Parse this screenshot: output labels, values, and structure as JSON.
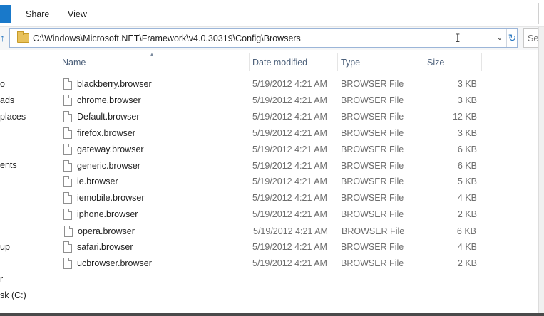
{
  "ribbon": {
    "tabs": [
      "Share",
      "View"
    ]
  },
  "address": {
    "path": "C:\\Windows\\Microsoft.NET\\Framework\\v4.0.30319\\Config\\Browsers",
    "cursor_glyph": "I",
    "dropdown_glyph": "⌄",
    "refresh_glyph": "↻",
    "search_partial": "Se"
  },
  "nav": {
    "items": [
      "o",
      "ads",
      "places",
      "",
      "ents",
      "",
      "up",
      "r",
      "sk (C:)"
    ]
  },
  "columns": {
    "name": "Name",
    "date": "Date modified",
    "type": "Type",
    "size": "Size"
  },
  "files": [
    {
      "name": "blackberry.browser",
      "date": "5/19/2012 4:21 AM",
      "type": "BROWSER File",
      "size": "3 KB"
    },
    {
      "name": "chrome.browser",
      "date": "5/19/2012 4:21 AM",
      "type": "BROWSER File",
      "size": "3 KB"
    },
    {
      "name": "Default.browser",
      "date": "5/19/2012 4:21 AM",
      "type": "BROWSER File",
      "size": "12 KB"
    },
    {
      "name": "firefox.browser",
      "date": "5/19/2012 4:21 AM",
      "type": "BROWSER File",
      "size": "3 KB"
    },
    {
      "name": "gateway.browser",
      "date": "5/19/2012 4:21 AM",
      "type": "BROWSER File",
      "size": "6 KB"
    },
    {
      "name": "generic.browser",
      "date": "5/19/2012 4:21 AM",
      "type": "BROWSER File",
      "size": "6 KB"
    },
    {
      "name": "ie.browser",
      "date": "5/19/2012 4:21 AM",
      "type": "BROWSER File",
      "size": "5 KB"
    },
    {
      "name": "iemobile.browser",
      "date": "5/19/2012 4:21 AM",
      "type": "BROWSER File",
      "size": "4 KB"
    },
    {
      "name": "iphone.browser",
      "date": "5/19/2012 4:21 AM",
      "type": "BROWSER File",
      "size": "2 KB"
    },
    {
      "name": "opera.browser",
      "date": "5/19/2012 4:21 AM",
      "type": "BROWSER File",
      "size": "6 KB"
    },
    {
      "name": "safari.browser",
      "date": "5/19/2012 4:21 AM",
      "type": "BROWSER File",
      "size": "4 KB"
    },
    {
      "name": "ucbrowser.browser",
      "date": "5/19/2012 4:21 AM",
      "type": "BROWSER File",
      "size": "2 KB"
    }
  ],
  "selected_file": "opera.browser",
  "colors": {
    "accent": "#1979ca",
    "header_text": "#4c607a",
    "muted_text": "#6d6d6d"
  }
}
